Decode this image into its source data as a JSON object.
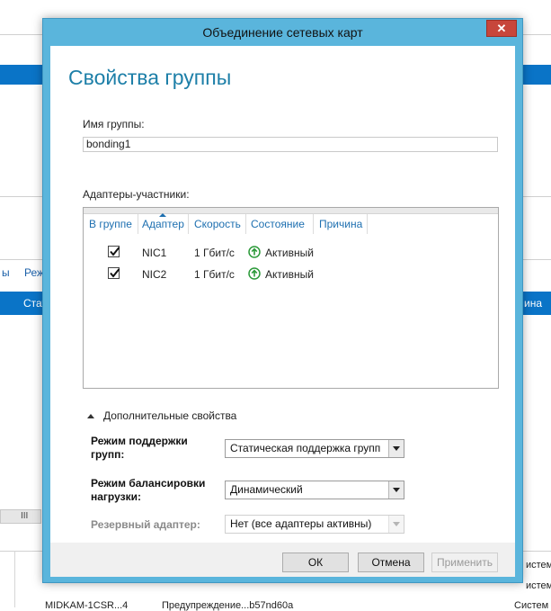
{
  "background": {
    "tabs": [
      "ы",
      "Реж"
    ],
    "header_left": "Стат",
    "header_right": "ина",
    "right_cells": [
      "истем",
      "истем",
      "Систем"
    ],
    "bottom_row": [
      "MIDKAM-1CSR...4",
      "Предупреждение...b57nd60a"
    ],
    "scroll_label": "III"
  },
  "dialog": {
    "title": "Объединение сетевых карт",
    "close_label": "✕",
    "heading": "Свойства группы",
    "group_name_label": "Имя группы:",
    "group_name_value": "bonding1",
    "adapters_label": "Адаптеры-участники:",
    "columns": [
      "В группе",
      "Адаптер",
      "Скорость",
      "Состояние",
      "Причина"
    ],
    "adapters": [
      {
        "in_group": true,
        "name": "NIC1",
        "speed": "1 Гбит/с",
        "state": "Активный",
        "reason": ""
      },
      {
        "in_group": true,
        "name": "NIC2",
        "speed": "1 Гбит/с",
        "state": "Активный",
        "reason": ""
      }
    ],
    "advanced_label": "Дополнительные свойства",
    "teaming_mode_label": "Режим поддержки групп:",
    "teaming_mode_value": "Статическая поддержка групп",
    "lb_mode_label": "Режим балансировки нагрузки:",
    "lb_mode_value": "Динамический",
    "standby_label": "Резервный адаптер:",
    "standby_value": "Нет (все адаптеры активны)",
    "ok_label": "ОК",
    "cancel_label": "Отмена",
    "apply_label": "Применить",
    "colors": {
      "title_bar": "#5ab5dc",
      "heading": "#1d7fa8",
      "status_ok": "#2c9a3a",
      "close": "#c7463b"
    }
  }
}
